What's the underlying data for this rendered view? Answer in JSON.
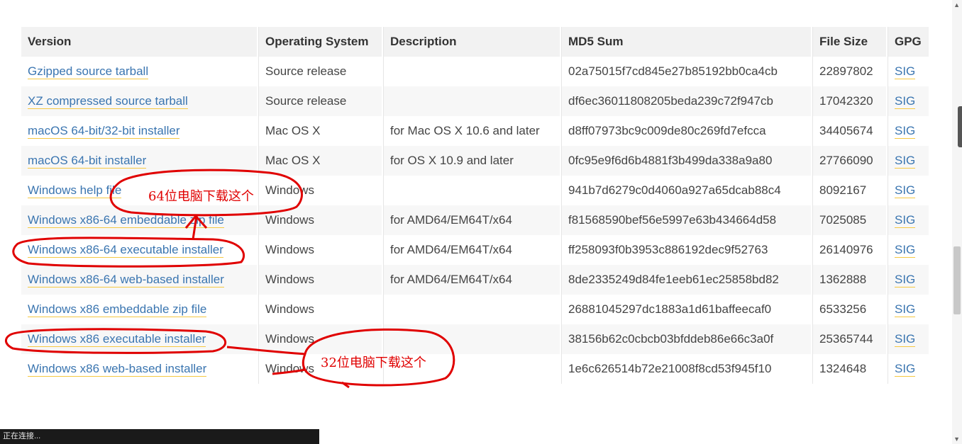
{
  "table": {
    "headers": [
      "Version",
      "Operating System",
      "Description",
      "MD5 Sum",
      "File Size",
      "GPG"
    ],
    "rows": [
      {
        "version": "Gzipped source tarball",
        "os": "Source release",
        "description": "",
        "md5": "02a75015f7cd845e27b85192bb0ca4cb",
        "size": "22897802",
        "gpg": "SIG"
      },
      {
        "version": "XZ compressed source tarball",
        "os": "Source release",
        "description": "",
        "md5": "df6ec36011808205beda239c72f947cb",
        "size": "17042320",
        "gpg": "SIG"
      },
      {
        "version": "macOS 64-bit/32-bit installer",
        "os": "Mac OS X",
        "description": "for Mac OS X 10.6 and later",
        "md5": "d8ff07973bc9c009de80c269fd7efcca",
        "size": "34405674",
        "gpg": "SIG"
      },
      {
        "version": "macOS 64-bit installer",
        "os": "Mac OS X",
        "description": "for OS X 10.9 and later",
        "md5": "0fc95e9f6d6b4881f3b499da338a9a80",
        "size": "27766090",
        "gpg": "SIG"
      },
      {
        "version": "Windows help file",
        "os": "Windows",
        "description": "",
        "md5": "941b7d6279c0d4060a927a65dcab88c4",
        "size": "8092167",
        "gpg": "SIG"
      },
      {
        "version": "Windows x86-64 embeddable zip file",
        "os": "Windows",
        "description": "for AMD64/EM64T/x64",
        "md5": "f81568590bef56e5997e63b434664d58",
        "size": "7025085",
        "gpg": "SIG"
      },
      {
        "version": "Windows x86-64 executable installer",
        "os": "Windows",
        "description": "for AMD64/EM64T/x64",
        "md5": "ff258093f0b3953c886192dec9f52763",
        "size": "26140976",
        "gpg": "SIG"
      },
      {
        "version": "Windows x86-64 web-based installer",
        "os": "Windows",
        "description": "for AMD64/EM64T/x64",
        "md5": "8de2335249d84fe1eeb61ec25858bd82",
        "size": "1362888",
        "gpg": "SIG"
      },
      {
        "version": "Windows x86 embeddable zip file",
        "os": "Windows",
        "description": "",
        "md5": "26881045297dc1883a1d61baffeecaf0",
        "size": "6533256",
        "gpg": "SIG"
      },
      {
        "version": "Windows x86 executable installer",
        "os": "Windows",
        "description": "",
        "md5": "38156b62c0cbcb03bfddeb86e66c3a0f",
        "size": "25365744",
        "gpg": "SIG"
      },
      {
        "version": "Windows x86 web-based installer",
        "os": "Windows",
        "description": "",
        "md5": "1e6c626514b72e21008f8cd53f945f10",
        "size": "1324648",
        "gpg": "SIG"
      }
    ]
  },
  "annotations": {
    "note_64": "64位电脑下载这个",
    "note_32": "32位电脑下载这个",
    "color": "#e00000"
  },
  "status_bar": {
    "text": "正在连接..."
  },
  "colors": {
    "link": "#3a75b0",
    "link_underline": "#f5c842",
    "header_bg": "#f2f2f2",
    "row_alt_bg": "#f7f7f7"
  }
}
